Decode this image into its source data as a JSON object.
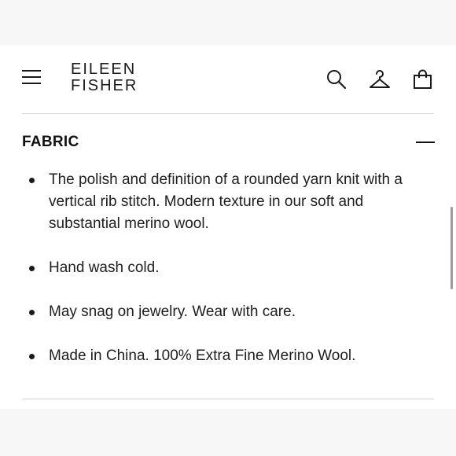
{
  "header": {
    "logo_line1": "EILEEN",
    "logo_line2": "FISHER",
    "icons": [
      "menu-icon",
      "search-icon",
      "account-hanger-icon",
      "shopping-bag-icon"
    ]
  },
  "section": {
    "title": "FABRIC",
    "toggle_icon": "minus-icon",
    "state": "expanded",
    "bullets": [
      {
        "text": "The polish and definition of a rounded yarn knit with a vertical rib stitch. Modern texture in our soft and substantial merino wool."
      },
      {
        "text": "Hand wash cold."
      },
      {
        "text": "May snag on jewelry. Wear with care."
      },
      {
        "text": "Made in China. 100% Extra Fine Merino Wool."
      }
    ]
  },
  "colors": {
    "text": "#1a1a1a",
    "background": "#ffffff",
    "divider": "#d6d6d6"
  }
}
